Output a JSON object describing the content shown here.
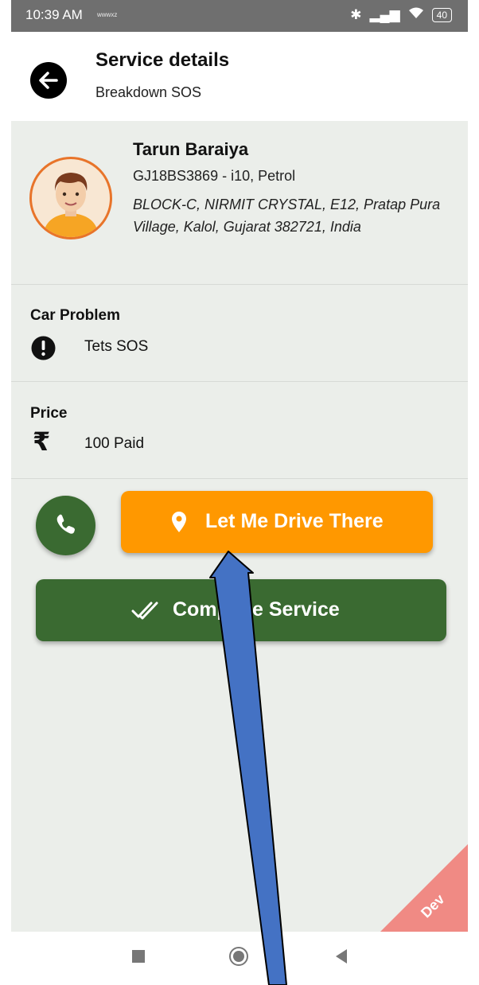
{
  "status_bar": {
    "time": "10:39 AM",
    "carrier_tag": "wwwxz",
    "battery": "40"
  },
  "header": {
    "title": "Service details",
    "subtitle": "Breakdown SOS",
    "back_icon": "arrow-left-icon"
  },
  "customer": {
    "name": "Tarun Baraiya",
    "vehicle": "GJ18BS3869 - i10, Petrol",
    "address": "BLOCK-C, NIRMIT CRYSTAL, E12, Pratap Pura Village, Kalol, Gujarat 382721, India"
  },
  "car_problem": {
    "title": "Car Problem",
    "value": "Tets SOS",
    "icon": "alert-circle-icon"
  },
  "price": {
    "title": "Price",
    "value": "100 Paid",
    "icon": "rupee-icon"
  },
  "actions": {
    "call_icon": "phone-icon",
    "drive_label": "Let Me Drive There",
    "drive_icon": "location-pin-icon",
    "complete_label": "Complete Service",
    "complete_icon": "double-check-icon"
  },
  "ribbon": {
    "label": "Dev"
  },
  "colors": {
    "primary_green": "#3a6a31",
    "accent_orange": "#ff9800",
    "background": "#ebeeea",
    "ribbon": "#f08a84",
    "annotation_arrow": "#4472c4"
  }
}
